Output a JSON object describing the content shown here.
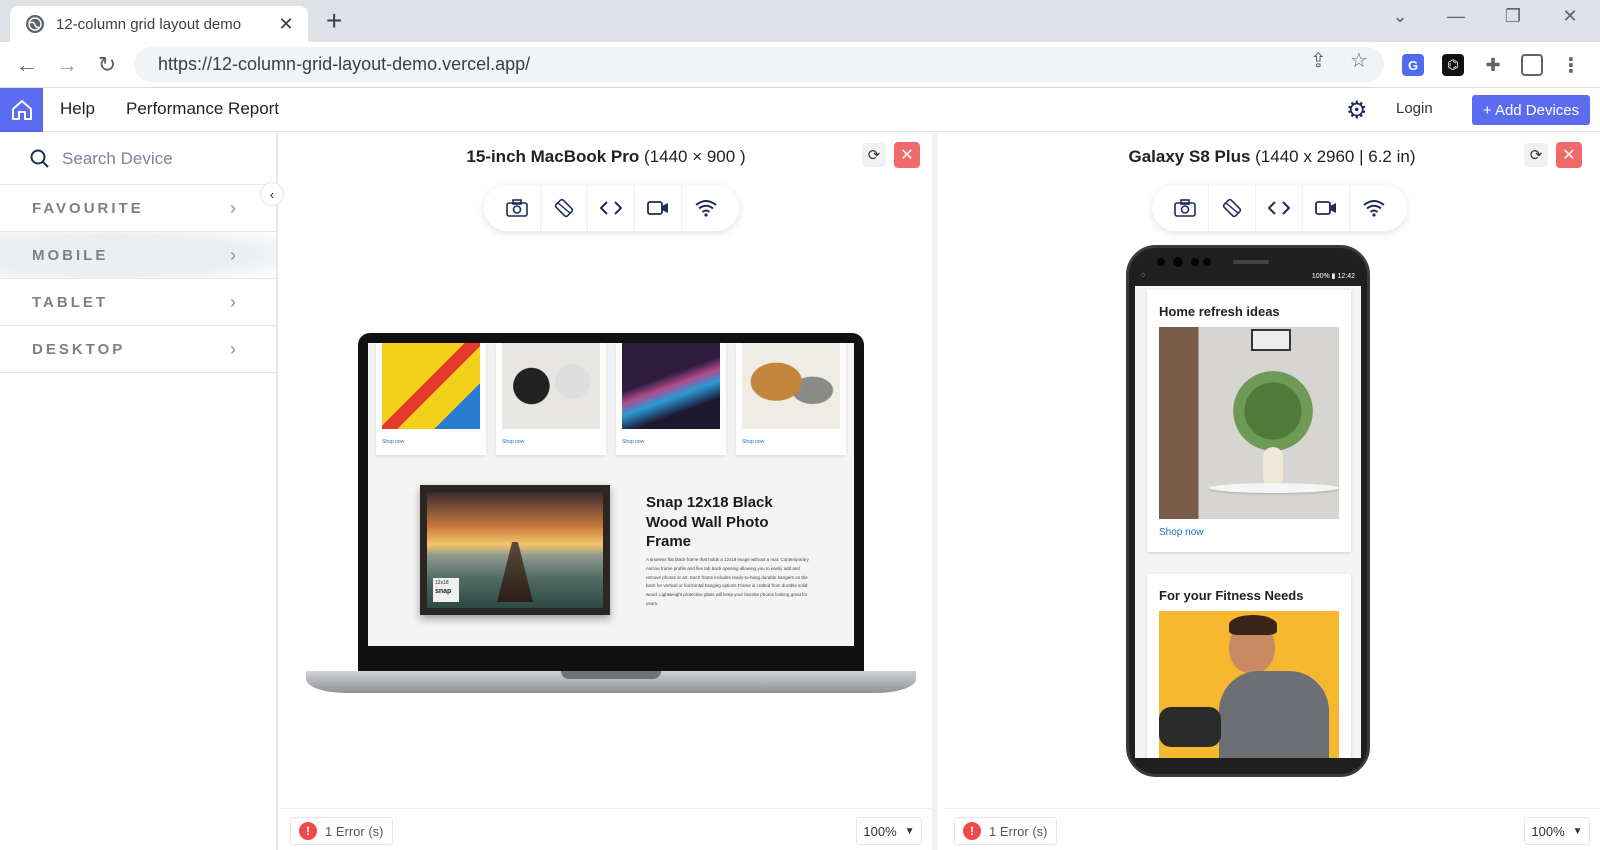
{
  "browser": {
    "tab_title": "12-column grid layout demo",
    "url": "https://12-column-grid-layout-demo.vercel.app/"
  },
  "header": {
    "nav": [
      "Help",
      "Performance Report"
    ],
    "login": "Login",
    "add_devices": "+ Add Devices"
  },
  "sidebar": {
    "search_placeholder": "Search Device",
    "categories": [
      "FAVOURITE",
      "MOBILE",
      "TABLET",
      "DESKTOP"
    ]
  },
  "panels": [
    {
      "device_name": "15-inch MacBook Pro",
      "device_spec": "(1440 × 900 )",
      "errors": "1 Error (s)",
      "zoom": "100%"
    },
    {
      "device_name": "Galaxy S8 Plus",
      "device_spec": "(1440 x 2960 | 6.2 in)",
      "errors": "1 Error (s)",
      "zoom": "100%"
    }
  ],
  "laptop_page": {
    "shop_link": "Shop now",
    "feature_title": "Snap 12x18 Black Wood Wall Photo Frame",
    "feature_desc": "A timeless flat black frame that holds a 12x18 image without a mat. Contemporary narrow frame profile and flex tab back opening allowing you to easily add and remove photos or art. Each frame includes ready-to-hang durable hangers on the back for vertical or horizontal hanging options.Frame is crafted from durable solid wood. Lightweight protective glass will keep your favorite photos looking great for years.",
    "frame_label_top": "12x18",
    "frame_label_brand": "snap"
  },
  "phone_page": {
    "status_left": "◌",
    "status_right": "100% ▮ 12:42",
    "card1_title": "Home refresh ideas",
    "card1_link": "Shop now",
    "card2_title": "For your Fitness Needs"
  },
  "colors": {
    "accent": "#5b6cf0",
    "close": "#f06a6a",
    "error": "#ee4b4b"
  }
}
